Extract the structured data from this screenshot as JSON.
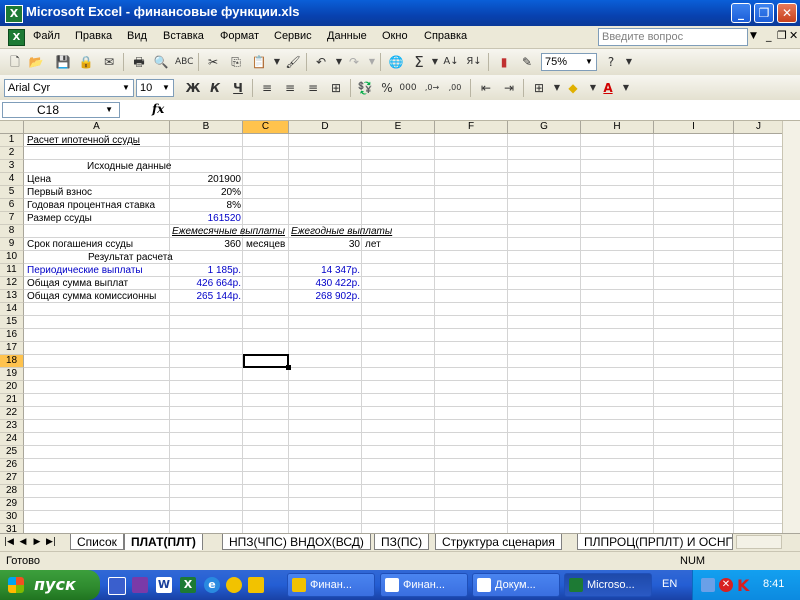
{
  "window": {
    "title": "Microsoft Excel - финансовые функции.xls"
  },
  "menu": [
    "Файл",
    "Правка",
    "Вид",
    "Вставка",
    "Формат",
    "Сервис",
    "Данные",
    "Окно",
    "Справка"
  ],
  "help_placeholder": "Введите вопрос",
  "toolbar": {
    "zoom": "75%"
  },
  "format_toolbar": {
    "font": "Arial Cyr",
    "size": "10",
    "bold": "Ж",
    "italic": "К",
    "underline": "Ч"
  },
  "formula_bar": {
    "cell_ref": "C18",
    "fx": "fx"
  },
  "columns": [
    "A",
    "B",
    "C",
    "D",
    "E",
    "F",
    "G",
    "H",
    "I",
    "J"
  ],
  "rows": [
    "1",
    "2",
    "3",
    "4",
    "5",
    "6",
    "7",
    "8",
    "9",
    "10",
    "11",
    "12",
    "13",
    "14",
    "15",
    "16",
    "17",
    "18",
    "19",
    "20",
    "21",
    "22",
    "23",
    "24",
    "25",
    "26",
    "27",
    "28",
    "29",
    "30",
    "31"
  ],
  "cells": {
    "A1": "Расчет ипотечной ссуды",
    "A3": "Исходные данные",
    "A4": "Цена",
    "B4": "201900",
    "A5": "Первый взнос",
    "B5": "20%",
    "A6": "Годовая процентная ставка",
    "B6": "8%",
    "A7": "Размер ссуды",
    "B7": "161520",
    "B8": "Ежемесячные выплаты",
    "D8": "Ежегодные выплаты",
    "A9": "Срок погашения ссуды",
    "B9": "360",
    "C9": "месяцев",
    "D9": "30",
    "E9": "лет",
    "A10": "Результат расчета",
    "A11": "Периодические выплаты",
    "B11": "1 185р.",
    "D11": "14 347р.",
    "A12": "Общая сумма выплат",
    "B12": "426 664р.",
    "D12": "430 422р.",
    "A13": "Общая сумма комиссионны",
    "B13": "265 144р.",
    "D13": "268 902р."
  },
  "sheet_tabs": [
    "Список",
    "ПЛАТ(ПЛТ)",
    "НПЗ(ЧПС) ВНДОХ(ВСД)",
    "ПЗ(ПС)",
    "Структура сценария",
    "ПЛПРОЦ(ПРПЛТ) И ОСНПЛ"
  ],
  "status": {
    "ready": "Готово",
    "num": "NUM"
  },
  "taskbar": {
    "start": "пуск",
    "tasks": [
      "Финан...",
      "Финан...",
      "Докум...",
      "Microso..."
    ],
    "lang": "EN",
    "clock": "8:41"
  }
}
